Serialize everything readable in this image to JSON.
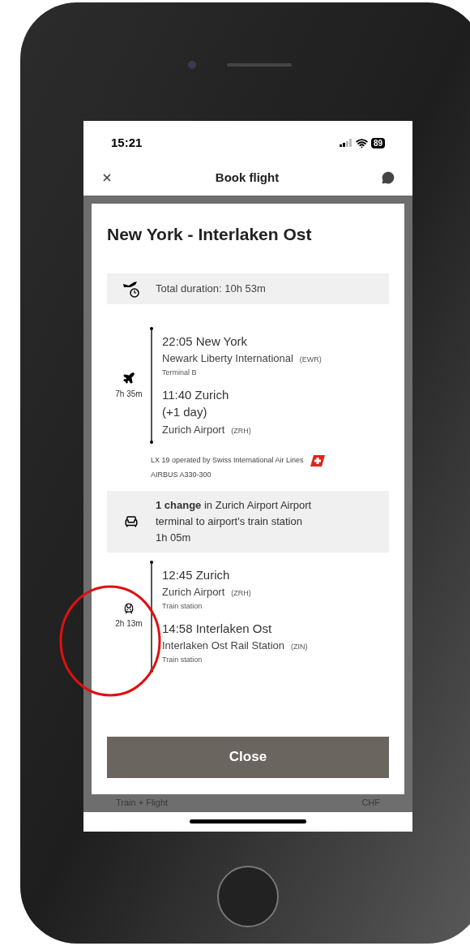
{
  "status_bar": {
    "time": "15:21",
    "battery": "89"
  },
  "header": {
    "title": "Book flight"
  },
  "modal": {
    "title": "New York - Interlaken Ost",
    "total_duration": "Total duration: 10h 53m",
    "segments": [
      {
        "kind": "flight",
        "duration": "7h 35m",
        "stops": [
          {
            "time_city": "22:05 New York",
            "station": "Newark Liberty International",
            "code": "(EWR)",
            "note": "Terminal B"
          },
          {
            "time_city": "11:40 Zurich",
            "day_offset": "(+1 day)",
            "station": "Zurich Airport",
            "code": "(ZRH)"
          }
        ],
        "operator": "LX 19  operated by Swiss International Air Lines",
        "aircraft": "AIRBUS A330-300"
      },
      {
        "kind": "change",
        "text": "**1 change** in Zurich Airport Airport terminal to airport's train station",
        "duration": "1h 05m"
      },
      {
        "kind": "train",
        "duration": "2h 13m",
        "stops": [
          {
            "time_city": "12:45 Zurich",
            "station": "Zurich Airport",
            "code": "(ZRH)",
            "note": "Train station"
          },
          {
            "time_city": "14:58 Interlaken Ost",
            "station": "Interlaken Ost Rail Station",
            "code": "(ZIN)",
            "note": "Train station"
          }
        ]
      }
    ],
    "close_button": "Close"
  },
  "background_row": {
    "label": "Train + Flight",
    "price": "CHF"
  }
}
